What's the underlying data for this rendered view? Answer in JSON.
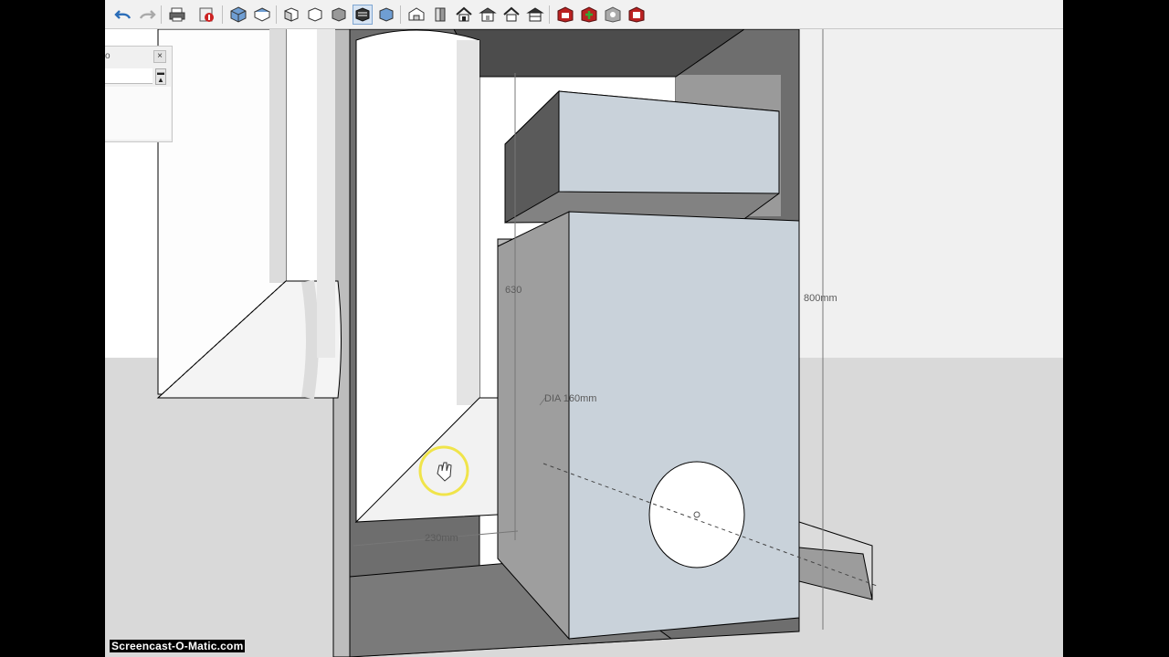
{
  "window": {
    "panel_title": "o",
    "panel_close": "×"
  },
  "toolbar": {
    "buttons": [
      {
        "name": "undo-icon"
      },
      {
        "name": "redo-icon"
      },
      {
        "name": "print-icon"
      },
      {
        "name": "model-info-icon"
      },
      {
        "name": "iso-view-icon"
      },
      {
        "name": "top-view-icon"
      },
      {
        "name": "front-view-icon"
      },
      {
        "name": "right-view-icon"
      },
      {
        "name": "back-view-icon"
      },
      {
        "name": "left-view-icon"
      },
      {
        "name": "xray-style-icon"
      },
      {
        "name": "wireframe-style-icon"
      },
      {
        "name": "hidden-line-style-icon"
      },
      {
        "name": "shaded-style-icon"
      },
      {
        "name": "textured-style-icon"
      },
      {
        "name": "monochrome-style-icon"
      },
      {
        "name": "house-iso-icon"
      },
      {
        "name": "house-top-icon"
      },
      {
        "name": "house-front-icon"
      },
      {
        "name": "house-right-icon"
      },
      {
        "name": "house-back-icon"
      },
      {
        "name": "house-left-icon"
      },
      {
        "name": "warehouse-get-icon"
      },
      {
        "name": "warehouse-share-icon"
      },
      {
        "name": "component-get-icon"
      },
      {
        "name": "extension-icon"
      }
    ]
  },
  "dimensions": {
    "height_630": "630",
    "height_800": "800mm",
    "diameter": "DIA 160mm",
    "width_230": "230mm"
  },
  "watermark": "Screencast-O-Matic.com",
  "colors": {
    "face_light": "#c9d2da",
    "face_dark": "#808080",
    "sky": "#ffffff",
    "ground": "#d9d9d9",
    "pipe": "#ffffff"
  }
}
